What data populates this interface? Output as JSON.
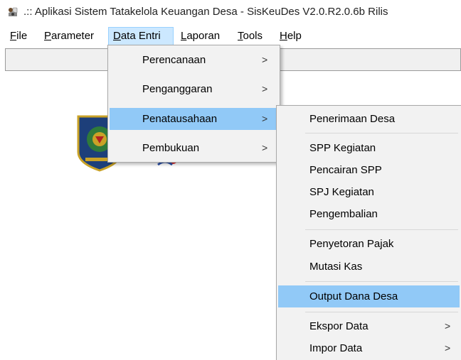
{
  "window": {
    "title": ".:: Aplikasi Sistem Tatakelola Keuangan Desa - SisKeuDes V2.0.R2.0.6b Rilis",
    "icon": "app-logo-icon"
  },
  "menubar": [
    {
      "label": "File",
      "ul": "F",
      "rest": "ile"
    },
    {
      "label": "Parameter",
      "ul": "P",
      "rest": "arameter"
    },
    {
      "label": "Data Entri",
      "ul": "D",
      "rest": "ata Entri"
    },
    {
      "label": "Laporan",
      "ul": "L",
      "rest": "aporan"
    },
    {
      "label": "Tools",
      "ul": "T",
      "rest": "ools"
    },
    {
      "label": "Help",
      "ul": "H",
      "rest": "elp"
    }
  ],
  "data_entri_menu": {
    "items": [
      {
        "label": "Perencanaan",
        "arrow": ">"
      },
      {
        "label": "Penganggaran",
        "arrow": ">"
      },
      {
        "label": "Penatausahaan",
        "arrow": ">"
      },
      {
        "label": "Pembukuan",
        "arrow": ">"
      }
    ]
  },
  "penatausahaan_menu": {
    "items": [
      {
        "label": "Penerimaan Desa"
      },
      {
        "label": "SPP Kegiatan"
      },
      {
        "label": "Pencairan SPP"
      },
      {
        "label": "SPJ Kegiatan"
      },
      {
        "label": "Pengembalian"
      },
      {
        "label": "Penyetoran Pajak"
      },
      {
        "label": "Mutasi Kas"
      },
      {
        "label": "Output Dana Desa"
      },
      {
        "label": "Ekspor Data",
        "arrow": ">"
      },
      {
        "label": "Impor Data",
        "arrow": ">"
      }
    ]
  },
  "colors": {
    "menu_highlight": "#91c9f7",
    "menubar_active": "#cce8ff",
    "menu_background": "#f2f2f2"
  }
}
